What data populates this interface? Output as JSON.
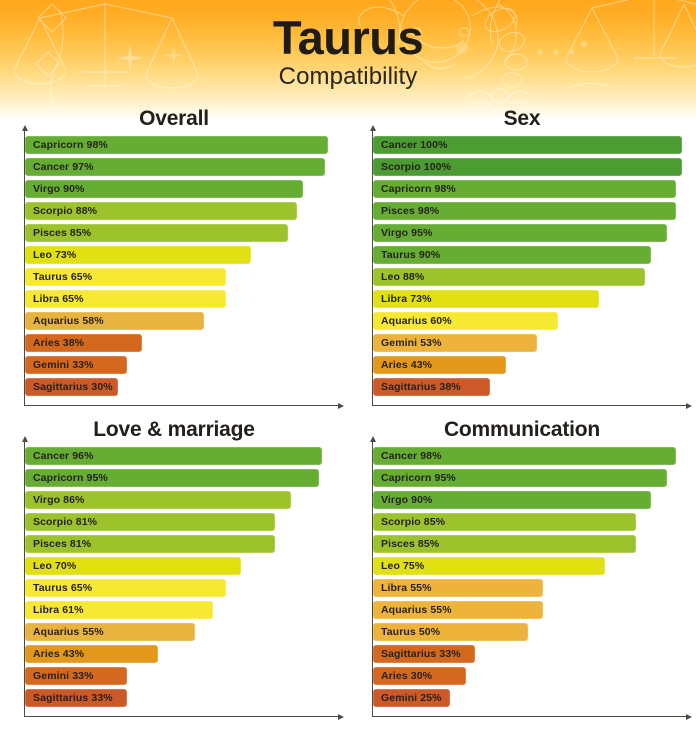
{
  "header": {
    "title": "Taurus",
    "subtitle": "Compatibility",
    "background_gradient_from": "#ffa81e",
    "background_gradient_to": "#ffffff",
    "decor": [
      "libra-scales-line-art",
      "taurus-bull-line-art",
      "scorpio-scorpion-line-art",
      "aquarius-waves-line-art",
      "sparkle-star"
    ]
  },
  "palette": {
    "dark_green": "#4a9c33",
    "green": "#66ad34",
    "yellow_green": "#9cc32c",
    "yellow": "#e1e013",
    "bright_yellow": "#f7e834",
    "light_gold": "#e8b33f",
    "gold": "#edb33b",
    "orange": "#e3981b",
    "dark_orange": "#d4681f",
    "red_orange": "#cc5a28"
  },
  "chart_data": [
    {
      "type": "bar",
      "orientation": "horizontal",
      "title": "Overall",
      "xlabel": "",
      "ylabel": "",
      "xlim": [
        0,
        100
      ],
      "grid": false,
      "legend": null,
      "axis_arrows": true,
      "categories": [
        "Capricorn",
        "Cancer",
        "Virgo",
        "Scorpio",
        "Pisces",
        "Leo",
        "Taurus",
        "Libra",
        "Aquarius",
        "Aries",
        "Gemini",
        "Sagittarius"
      ],
      "values": [
        98,
        97,
        90,
        88,
        85,
        73,
        65,
        65,
        58,
        38,
        33,
        30
      ],
      "labels": [
        "Capricorn 98%",
        "Cancer 97%",
        "Virgo 90%",
        "Scorpio 88%",
        "Pisces 85%",
        "Leo 73%",
        "Taurus 65%",
        "Libra 65%",
        "Aquarius 58%",
        "Aries 38%",
        "Gemini 33%",
        "Sagittarius 30%"
      ],
      "colors": [
        "#66ad34",
        "#66ad34",
        "#66ad34",
        "#9cc32c",
        "#9cc32c",
        "#e1e013",
        "#f7e834",
        "#f7e834",
        "#e8b33f",
        "#d4681f",
        "#d4681f",
        "#cc5a28"
      ]
    },
    {
      "type": "bar",
      "orientation": "horizontal",
      "title": "Sex",
      "xlabel": "",
      "ylabel": "",
      "xlim": [
        0,
        100
      ],
      "grid": false,
      "legend": null,
      "axis_arrows": true,
      "categories": [
        "Cancer",
        "Scorpio",
        "Capricorn",
        "Pisces",
        "Virgo",
        "Taurus",
        "Leo",
        "Libra",
        "Aquarius",
        "Gemini",
        "Aries",
        "Sagittarius"
      ],
      "values": [
        100,
        100,
        98,
        98,
        95,
        90,
        88,
        73,
        60,
        53,
        43,
        38
      ],
      "labels": [
        "Cancer 100%",
        "Scorpio 100%",
        "Capricorn 98%",
        "Pisces 98%",
        "Virgo 95%",
        "Taurus 90%",
        "Leo 88%",
        "Libra 73%",
        "Aquarius 60%",
        "Gemini 53%",
        "Aries 43%",
        "Sagittarius 38%"
      ],
      "colors": [
        "#4a9c33",
        "#4a9c33",
        "#66ad34",
        "#66ad34",
        "#66ad34",
        "#66ad34",
        "#9cc32c",
        "#e1e013",
        "#f7e834",
        "#edb33b",
        "#e3981b",
        "#cc5a28"
      ]
    },
    {
      "type": "bar",
      "orientation": "horizontal",
      "title": "Love & marriage",
      "xlabel": "",
      "ylabel": "",
      "xlim": [
        0,
        100
      ],
      "grid": false,
      "legend": null,
      "axis_arrows": true,
      "categories": [
        "Cancer",
        "Capricorn",
        "Virgo",
        "Scorpio",
        "Pisces",
        "Leo",
        "Taurus",
        "Libra",
        "Aquarius",
        "Aries",
        "Gemini",
        "Sagittarius"
      ],
      "values": [
        96,
        95,
        86,
        81,
        81,
        70,
        65,
        61,
        55,
        43,
        33,
        33
      ],
      "labels": [
        "Cancer 96%",
        "Capricorn 95%",
        "Virgo 86%",
        "Scorpio 81%",
        "Pisces 81%",
        "Leo 70%",
        "Taurus 65%",
        "Libra 61%",
        "Aquarius 55%",
        "Aries 43%",
        "Gemini 33%",
        "Sagittarius 33%"
      ],
      "colors": [
        "#66ad34",
        "#66ad34",
        "#9cc32c",
        "#9cc32c",
        "#9cc32c",
        "#e1e013",
        "#f7e834",
        "#f7e834",
        "#e8b33f",
        "#e3981b",
        "#d4681f",
        "#cc5a28"
      ]
    },
    {
      "type": "bar",
      "orientation": "horizontal",
      "title": "Communication",
      "xlabel": "",
      "ylabel": "",
      "xlim": [
        0,
        100
      ],
      "grid": false,
      "legend": null,
      "axis_arrows": true,
      "categories": [
        "Cancer",
        "Capricorn",
        "Virgo",
        "Scorpio",
        "Pisces",
        "Leo",
        "Libra",
        "Aquarius",
        "Taurus",
        "Sagittarius",
        "Aries",
        "Gemini"
      ],
      "values": [
        98,
        95,
        90,
        85,
        85,
        75,
        55,
        55,
        50,
        33,
        30,
        25
      ],
      "labels": [
        "Cancer 98%",
        "Capricorn 95%",
        "Virgo 90%",
        "Scorpio 85%",
        "Pisces 85%",
        "Leo 75%",
        "Libra 55%",
        "Aquarius 55%",
        "Taurus 50%",
        "Sagittarius 33%",
        "Aries 30%",
        "Gemini 25%"
      ],
      "colors": [
        "#66ad34",
        "#66ad34",
        "#66ad34",
        "#9cc32c",
        "#9cc32c",
        "#e1e013",
        "#edb33b",
        "#edb33b",
        "#edb33b",
        "#d4681f",
        "#d4681f",
        "#cc5a28"
      ]
    }
  ]
}
